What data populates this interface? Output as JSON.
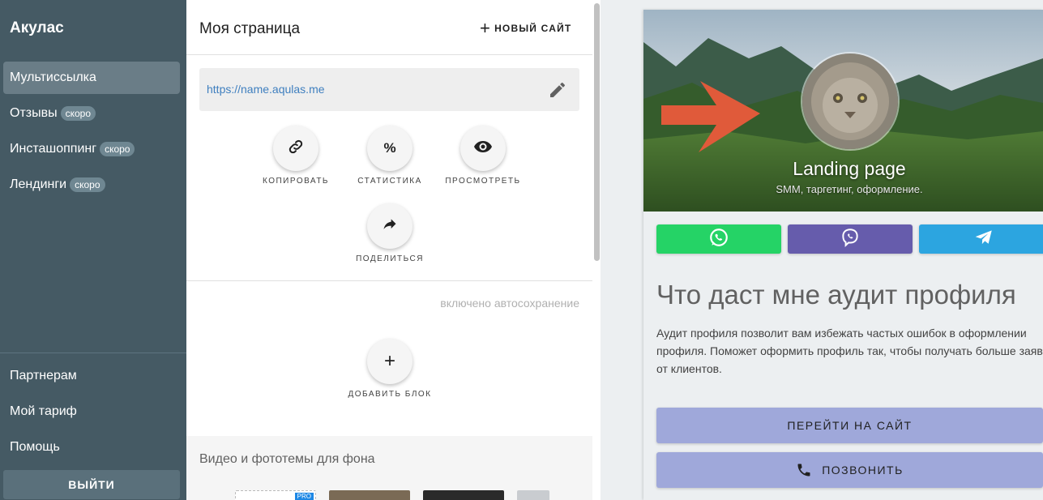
{
  "sidebar": {
    "brand": "Акулас",
    "items": [
      {
        "label": "Мультиссылка",
        "badge": ""
      },
      {
        "label": "Отзывы",
        "badge": "скоро"
      },
      {
        "label": "Инсташоппинг",
        "badge": "скоро"
      },
      {
        "label": "Лендинги",
        "badge": "скоро"
      }
    ],
    "bottom_items": [
      {
        "label": "Партнерам"
      },
      {
        "label": "Мой тариф"
      },
      {
        "label": "Помощь"
      }
    ],
    "logout_label": "ВЫЙТИ"
  },
  "editor": {
    "title": "Моя страница",
    "new_site_label": "НОВЫЙ САЙТ",
    "url": "https://name.aqulas.me",
    "actions": [
      {
        "label": "КОПИРОВАТЬ",
        "icon": "link-icon"
      },
      {
        "label": "СТАТИСТИКА",
        "icon": "percent-icon",
        "glyph": "%"
      },
      {
        "label": "ПРОСМОТРЕТЬ",
        "icon": "eye-icon"
      },
      {
        "label": "ПОДЕЛИТЬСЯ",
        "icon": "share-icon"
      }
    ],
    "autosave_text": "включено автосохранение",
    "add_block_label": "ДОБАВИТЬ БЛОК",
    "add_block_glyph": "+",
    "backgrounds_title": "Видео и фототемы для фона",
    "pro_badge": "PRO"
  },
  "preview": {
    "hero_title": "Landing page",
    "hero_subtitle": "SMM, таргетинг, оформление.",
    "messengers": [
      {
        "name": "whatsapp",
        "color": "#25d366"
      },
      {
        "name": "viber",
        "color": "#665cac"
      },
      {
        "name": "telegram",
        "color": "#2ca5e0"
      }
    ],
    "heading": "Что даст мне аудит профиля",
    "description": "Аудит профиля позволит вам избежать частых ошибок в оформлении профиля. Поможет оформить профиль так, чтобы получать больше заявок от клиентов.",
    "cta_site": "ПЕРЕЙТИ НА САЙТ",
    "cta_call": "ПОЗВОНИТЬ"
  },
  "colors": {
    "sidebar_bg": "#455a64",
    "arrow": "#e05a3a",
    "cta_bg": "#9fa8da",
    "link": "#3f7fbf"
  }
}
